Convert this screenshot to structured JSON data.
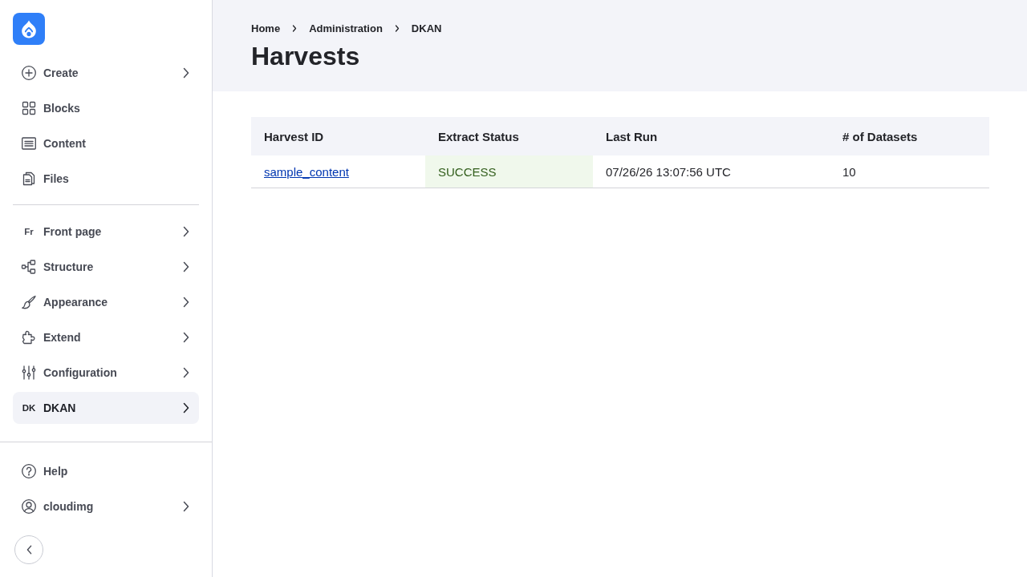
{
  "sidebar": {
    "primary_items": [
      {
        "label": "Create",
        "has_submenu": true,
        "selected": false
      },
      {
        "label": "Blocks",
        "has_submenu": false,
        "selected": false
      },
      {
        "label": "Content",
        "has_submenu": false,
        "selected": false
      },
      {
        "label": "Files",
        "has_submenu": false,
        "selected": false
      }
    ],
    "secondary_items": [
      {
        "label": "Front page",
        "abbr": "Fr",
        "has_submenu": true,
        "selected": false
      },
      {
        "label": "Structure",
        "has_submenu": true,
        "selected": false
      },
      {
        "label": "Appearance",
        "has_submenu": true,
        "selected": false
      },
      {
        "label": "Extend",
        "has_submenu": true,
        "selected": false
      },
      {
        "label": "Configuration",
        "has_submenu": true,
        "selected": false
      },
      {
        "label": "DKAN",
        "abbr": "DK",
        "has_submenu": true,
        "selected": true
      }
    ],
    "footer_items": [
      {
        "label": "Help",
        "has_submenu": false,
        "selected": false
      },
      {
        "label": "cloudimg",
        "has_submenu": true,
        "selected": false
      }
    ]
  },
  "breadcrumb": [
    "Home",
    "Administration",
    "DKAN"
  ],
  "page_title": "Harvests",
  "table": {
    "columns": [
      "Harvest ID",
      "Extract Status",
      "Last Run",
      "# of Datasets"
    ],
    "rows": [
      {
        "harvest_id": "sample_content",
        "extract_status": {
          "text": "SUCCESS",
          "kind": "success"
        },
        "last_run": "07/26/26 13:07:56 UTC",
        "datasets": "10"
      }
    ]
  }
}
